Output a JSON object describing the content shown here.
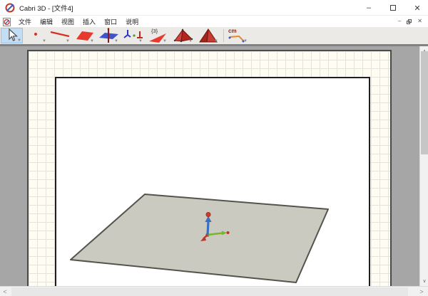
{
  "window": {
    "title": "Cabri 3D - [文件4]"
  },
  "titlebar": {
    "minimize_glyph": "–",
    "close_glyph": "✕"
  },
  "menu": {
    "items": [
      {
        "label": "文件"
      },
      {
        "label": "编辑"
      },
      {
        "label": "视图"
      },
      {
        "label": "插入"
      },
      {
        "label": "窗口"
      },
      {
        "label": "说明"
      }
    ],
    "mdi": {
      "minimize_glyph": "–",
      "close_glyph": "✕"
    }
  },
  "toolbar": {
    "tools": [
      {
        "name": "manipulation",
        "selected": true
      },
      {
        "name": "points"
      },
      {
        "name": "lines"
      },
      {
        "name": "planes"
      },
      {
        "name": "perpendicular-plane"
      },
      {
        "name": "trihedron"
      },
      {
        "name": "polygons",
        "badge": "{3}"
      },
      {
        "name": "polyhedra"
      },
      {
        "name": "regular-polyhedra"
      },
      {
        "name": "measurement",
        "label": "cm"
      }
    ]
  },
  "scrollbars": {
    "up": "∧",
    "down": "∨",
    "left": "<",
    "right": ">"
  },
  "scene": {
    "plane_fill": "#CBCAC1",
    "plane_stroke": "#55544C",
    "axis_z_color": "#3E6FBB",
    "axis_y_color": "#76B82A",
    "axis_x_color": "#C03427",
    "origin_color": "#C03427"
  },
  "colors": {
    "toolbar_bg": "#ECEAE6",
    "selected_tool_bg": "#C2DDF4",
    "canvas_bg": "#A6A6A6",
    "grid_paper_bg": "#FFFDF2",
    "grid_line": "#E3E2DB",
    "tool_red": "#E8392E",
    "tool_blue": "#4053C8"
  }
}
